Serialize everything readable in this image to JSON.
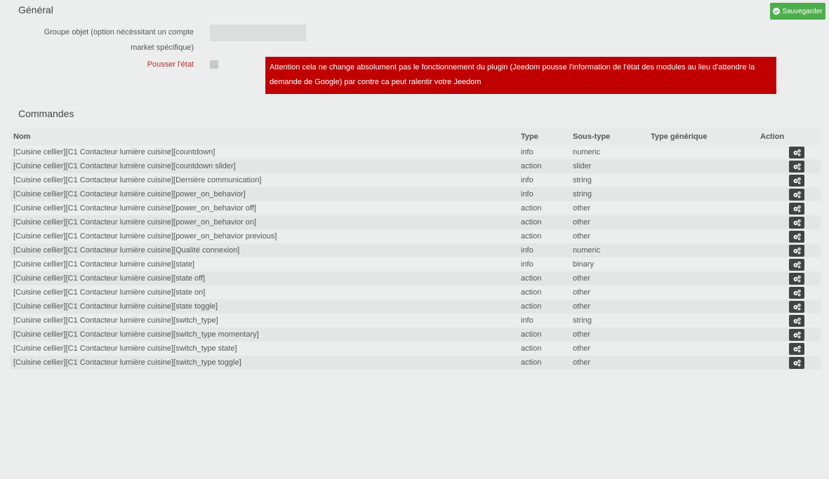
{
  "general": {
    "title": "Général",
    "save_label": "Sauvegarder",
    "group_label_line1": "Groupe objet (option nécéssitant un compte",
    "group_label_line2": "market spécifique)",
    "group_value": "",
    "push_label": "Pousser l'état",
    "push_checked": false,
    "alert_text": "Attention cela ne change absolument pas le fonctionnement du plugin (Jeedom pousse l'information de l'état des modules au lieu d'attendre la demande de Google) par contre ca peut ralentir votre Jeedom"
  },
  "commands": {
    "title": "Commandes",
    "headers": {
      "nom": "Nom",
      "type": "Type",
      "sous_type": "Sous-type",
      "type_generique": "Type générique",
      "action": "Action"
    },
    "rows": [
      {
        "nom": "[Cuisine cellier][C1 Contacteur lumière cuisine][countdown]",
        "type": "info",
        "sous_type": "numeric",
        "type_generique": ""
      },
      {
        "nom": "[Cuisine cellier][C1 Contacteur lumière cuisine][countdown slider]",
        "type": "action",
        "sous_type": "slider",
        "type_generique": ""
      },
      {
        "nom": "[Cuisine cellier][C1 Contacteur lumière cuisine][Dernière communication]",
        "type": "info",
        "sous_type": "string",
        "type_generique": ""
      },
      {
        "nom": "[Cuisine cellier][C1 Contacteur lumière cuisine][power_on_behavior]",
        "type": "info",
        "sous_type": "string",
        "type_generique": ""
      },
      {
        "nom": "[Cuisine cellier][C1 Contacteur lumière cuisine][power_on_behavior off]",
        "type": "action",
        "sous_type": "other",
        "type_generique": ""
      },
      {
        "nom": "[Cuisine cellier][C1 Contacteur lumière cuisine][power_on_behavior on]",
        "type": "action",
        "sous_type": "other",
        "type_generique": ""
      },
      {
        "nom": "[Cuisine cellier][C1 Contacteur lumière cuisine][power_on_behavior previous]",
        "type": "action",
        "sous_type": "other",
        "type_generique": ""
      },
      {
        "nom": "[Cuisine cellier][C1 Contacteur lumière cuisine][Qualité connexion]",
        "type": "info",
        "sous_type": "numeric",
        "type_generique": ""
      },
      {
        "nom": "[Cuisine cellier][C1 Contacteur lumière cuisine][state]",
        "type": "info",
        "sous_type": "binary",
        "type_generique": ""
      },
      {
        "nom": "[Cuisine cellier][C1 Contacteur lumière cuisine][state off]",
        "type": "action",
        "sous_type": "other",
        "type_generique": ""
      },
      {
        "nom": "[Cuisine cellier][C1 Contacteur lumière cuisine][state on]",
        "type": "action",
        "sous_type": "other",
        "type_generique": ""
      },
      {
        "nom": "[Cuisine cellier][C1 Contacteur lumière cuisine][state toggle]",
        "type": "action",
        "sous_type": "other",
        "type_generique": ""
      },
      {
        "nom": "[Cuisine cellier][C1 Contacteur lumière cuisine][switch_type]",
        "type": "info",
        "sous_type": "string",
        "type_generique": ""
      },
      {
        "nom": "[Cuisine cellier][C1 Contacteur lumière cuisine][switch_type momentary]",
        "type": "action",
        "sous_type": "other",
        "type_generique": ""
      },
      {
        "nom": "[Cuisine cellier][C1 Contacteur lumière cuisine][switch_type state]",
        "type": "action",
        "sous_type": "other",
        "type_generique": ""
      },
      {
        "nom": "[Cuisine cellier][C1 Contacteur lumière cuisine][switch_type toggle]",
        "type": "action",
        "sous_type": "other",
        "type_generique": ""
      }
    ]
  },
  "icons": {
    "save": "check-circle-icon",
    "row_action": "cogs-icon"
  },
  "colors": {
    "save_button": "#4cae4c",
    "alert": "#c00000",
    "push_label": "#b03030",
    "action_button": "#444444"
  }
}
